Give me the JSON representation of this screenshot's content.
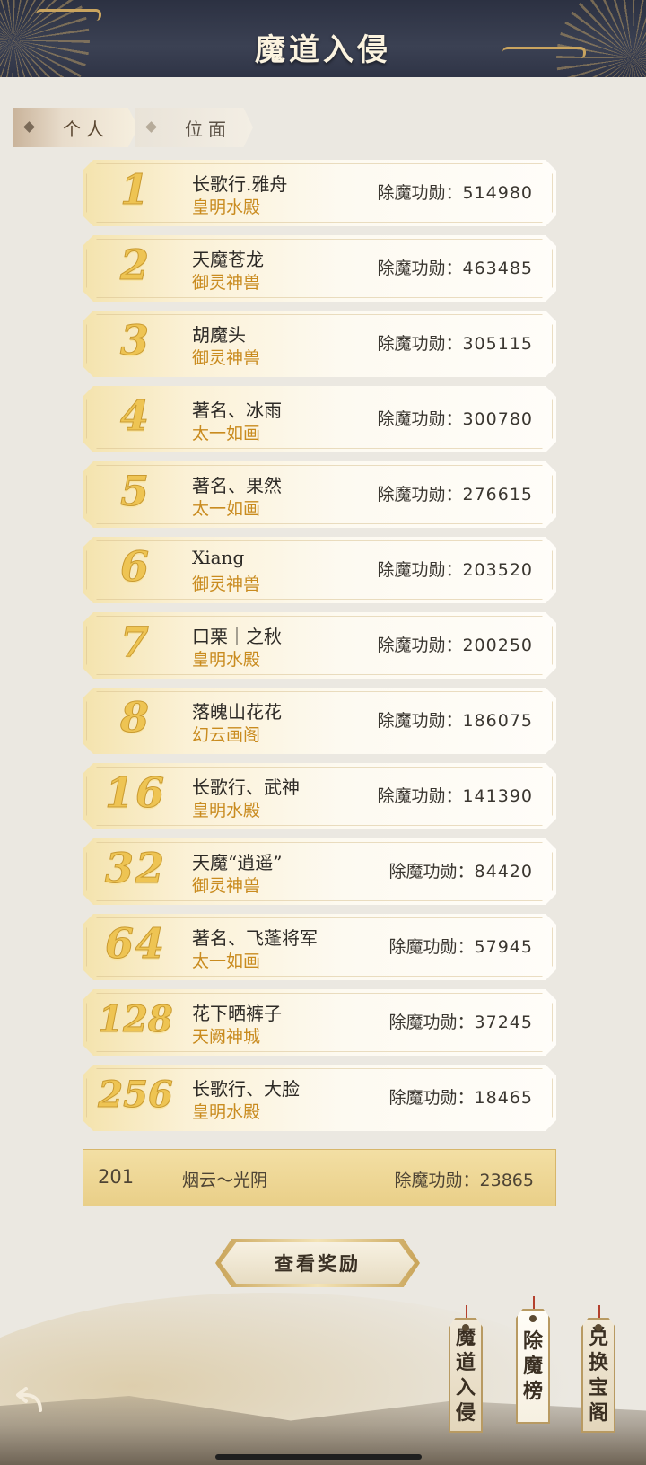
{
  "header": {
    "title": "魔道入侵"
  },
  "tabs": [
    {
      "label": "个人",
      "active": true
    },
    {
      "label": "位面",
      "active": false
    }
  ],
  "merit_label": "除魔功勋：",
  "ranking": [
    {
      "rank": "1",
      "name": "长歌行.雅舟",
      "faction": "皇明水殿",
      "merit": "514980"
    },
    {
      "rank": "2",
      "name": "天魔苍龙",
      "faction": "御灵神兽",
      "merit": "463485"
    },
    {
      "rank": "3",
      "name": "胡魔头",
      "faction": "御灵神兽",
      "merit": "305115"
    },
    {
      "rank": "4",
      "name": "著名、冰雨",
      "faction": "太一如画",
      "merit": "300780"
    },
    {
      "rank": "5",
      "name": "著名、果然",
      "faction": "太一如画",
      "merit": "276615"
    },
    {
      "rank": "6",
      "name": "Xiang",
      "faction": "御灵神兽",
      "merit": "203520"
    },
    {
      "rank": "7",
      "name": "口栗｜之秋",
      "faction": "皇明水殿",
      "merit": "200250"
    },
    {
      "rank": "8",
      "name": "落魄山花花",
      "faction": "幻云画阁",
      "merit": "186075"
    },
    {
      "rank": "16",
      "name": "长歌行、武神",
      "faction": "皇明水殿",
      "merit": "141390"
    },
    {
      "rank": "32",
      "name": "天魔“逍遥”",
      "faction": "御灵神兽",
      "merit": "84420"
    },
    {
      "rank": "64",
      "name": "著名、飞蓬将军",
      "faction": "太一如画",
      "merit": "57945"
    },
    {
      "rank": "128",
      "name": "花下晒裤子",
      "faction": "天阙神城",
      "merit": "37245"
    },
    {
      "rank": "256",
      "name": "长歌行、大脸",
      "faction": "皇明水殿",
      "merit": "18465"
    }
  ],
  "my_rank": {
    "rank": "201",
    "name": "烟云～光阴",
    "merit_label": "除魔功勋：",
    "merit": "23865"
  },
  "reward_button": {
    "label": "查看奖励"
  },
  "bottom_tags": [
    {
      "label": "魔道入侵",
      "active": false
    },
    {
      "label": "除魔榜",
      "active": true
    },
    {
      "label": "兑换宝阁",
      "active": false
    }
  ],
  "icons": {
    "back": "back-arrow-icon"
  }
}
